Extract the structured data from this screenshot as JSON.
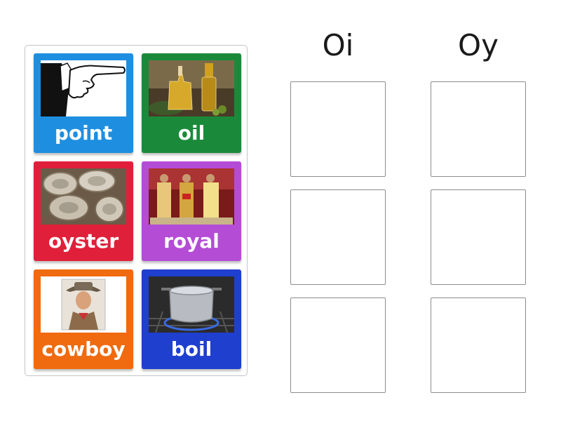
{
  "cards": [
    {
      "word": "point",
      "color": "#1e8fe0",
      "image": "pointing-hand-image"
    },
    {
      "word": "oil",
      "color": "#1a8a3a",
      "image": "oil-bottles-image"
    },
    {
      "word": "oyster",
      "color": "#e0203a",
      "image": "oysters-image"
    },
    {
      "word": "royal",
      "color": "#b44cd6",
      "image": "royal-family-image"
    },
    {
      "word": "cowboy",
      "color": "#f06a10",
      "image": "cowboy-image"
    },
    {
      "word": "boil",
      "color": "#1f3fcf",
      "image": "boiling-pot-image"
    }
  ],
  "columns": [
    {
      "heading": "Oi"
    },
    {
      "heading": "Oy"
    }
  ]
}
